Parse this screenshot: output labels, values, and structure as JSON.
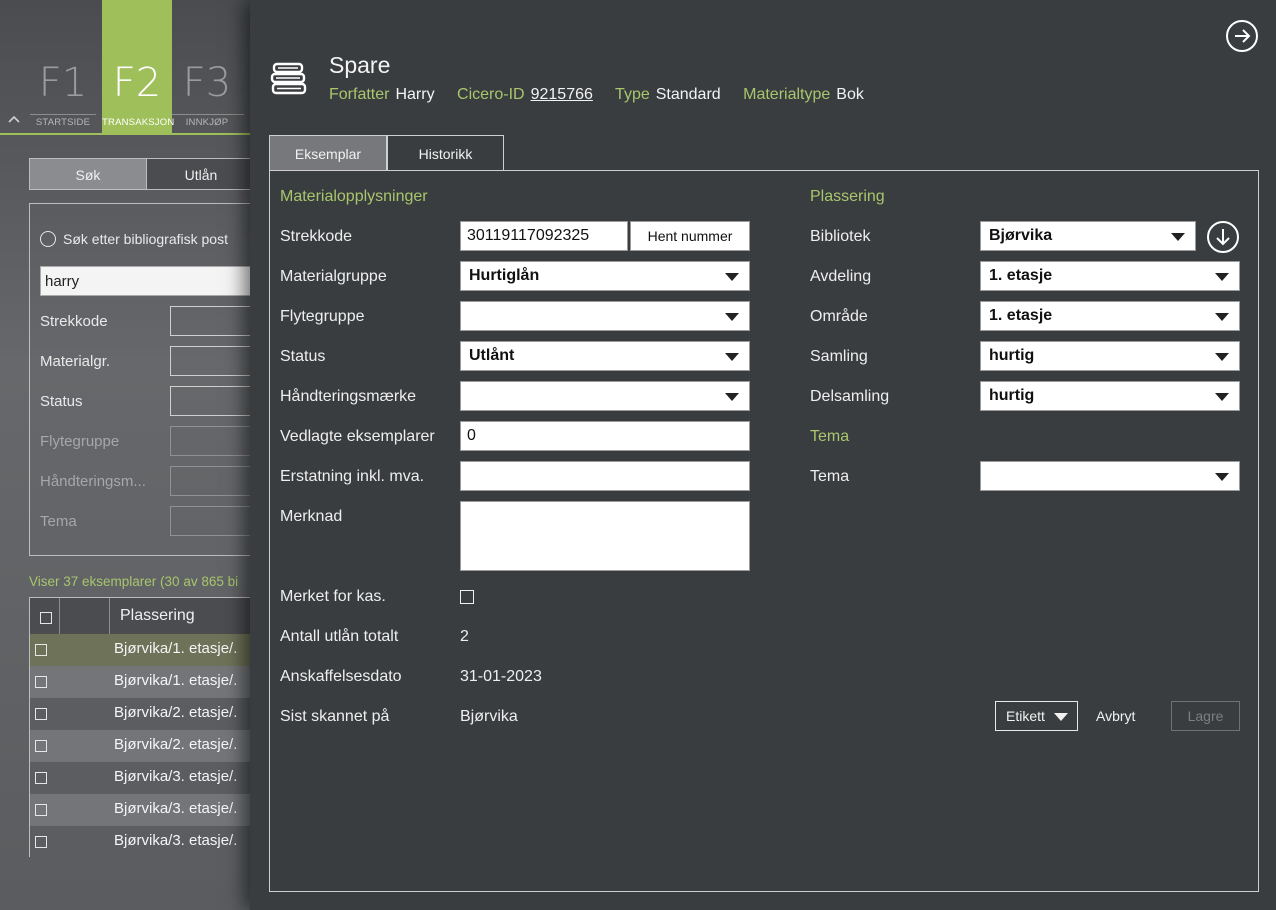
{
  "background_app": {
    "fkeys": [
      {
        "key": "F1",
        "label": "STARTSIDE"
      },
      {
        "key": "F2",
        "label": "TRANSAKSJON"
      },
      {
        "key": "F3",
        "label": "INNKJØP"
      }
    ],
    "tabs": {
      "sok": "Søk",
      "utlan": "Utlån"
    },
    "search": {
      "radio_label": "Søk etter bibliografisk post",
      "query": "harry",
      "fields": [
        "Strekkode",
        "Materialgr.",
        "Status",
        "Flytegruppe",
        "Håndteringsm...",
        "Tema"
      ]
    },
    "results_count": "Viser 37 eksemplarer (30 av 865 bi",
    "results_header": "Plassering",
    "results_rows": [
      "Bjørvika/1. etasje/.",
      "Bjørvika/1. etasje/.",
      "Bjørvika/2. etasje/.",
      "Bjørvika/2. etasje/.",
      "Bjørvika/3. etasje/.",
      "Bjørvika/3. etasje/.",
      "Bjørvika/3. etasje/."
    ]
  },
  "record": {
    "title": "Spare",
    "meta": {
      "forfatter_label": "Forfatter",
      "forfatter": "Harry",
      "cicero_label": "Cicero-ID",
      "cicero_id": "9215766",
      "type_label": "Type",
      "type": "Standard",
      "materialtype_label": "Materialtype",
      "materialtype": "Bok"
    },
    "tabs": {
      "eksemplar": "Eksemplar",
      "historikk": "Historikk"
    }
  },
  "material": {
    "section": "Materialopplysninger",
    "strekkode_label": "Strekkode",
    "strekkode": "30119117092325",
    "hent_nummer": "Hent nummer",
    "materialgruppe_label": "Materialgruppe",
    "materialgruppe": "Hurtiglån",
    "flytegruppe_label": "Flytegruppe",
    "flytegruppe": "",
    "status_label": "Status",
    "status": "Utlånt",
    "handtering_label": "Håndteringsmærke",
    "handtering": "",
    "vedlagte_label": "Vedlagte eksemplarer",
    "vedlagte": "0",
    "erstatning_label": "Erstatning inkl. mva.",
    "erstatning": "",
    "merknad_label": "Merknad",
    "merknad": "",
    "kas_label": "Merket for kas.",
    "antall_label": "Antall utlån totalt",
    "antall": "2",
    "anskaffelse_label": "Anskaffelsesdato",
    "anskaffelse": "31-01-2023",
    "skannet_label": "Sist skannet på",
    "skannet": "Bjørvika"
  },
  "placement": {
    "section": "Plassering",
    "bibliotek_label": "Bibliotek",
    "bibliotek": "Bjørvika",
    "avdeling_label": "Avdeling",
    "avdeling": "1. etasje",
    "omrade_label": "Område",
    "omrade": "1. etasje",
    "samling_label": "Samling",
    "samling": "hurtig",
    "delsamling_label": "Delsamling",
    "delsamling": "hurtig"
  },
  "tema": {
    "section": "Tema",
    "label": "Tema",
    "value": ""
  },
  "actions": {
    "etikett": "Etikett",
    "avbryt": "Avbryt",
    "lagre": "Lagre"
  },
  "icons": {
    "close": "arrow-right-circle-icon",
    "download": "arrow-down-circle-icon",
    "book": "book-stack-icon"
  },
  "colors": {
    "accent": "#a8c66c",
    "active_fkey": "#9fbf5a"
  }
}
